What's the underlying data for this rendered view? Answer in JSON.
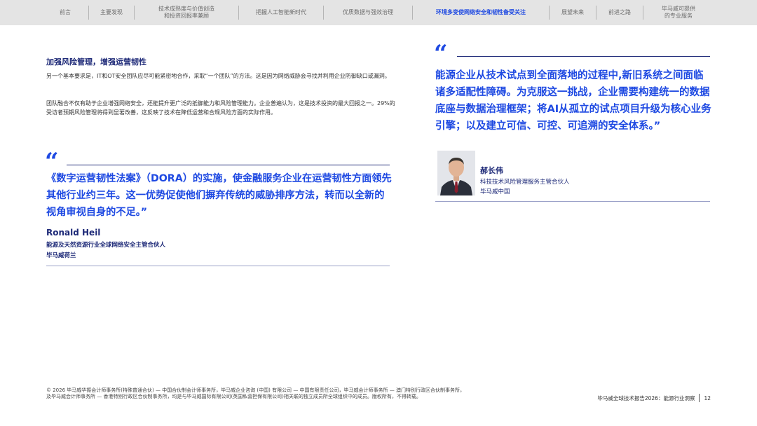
{
  "nav": {
    "items": [
      {
        "label": "前言"
      },
      {
        "label": "主要发现"
      },
      {
        "label": "技术成熟度与价值创造\n和投资回报率兼顾"
      },
      {
        "label": "把握人工智能新时代"
      },
      {
        "label": "优质数据与强效治理"
      },
      {
        "label": "环境多变使网络安全和韧性备受关注"
      },
      {
        "label": "展望未来"
      },
      {
        "label": "前进之路"
      },
      {
        "label": "毕马威可提供\n的专业服务"
      }
    ],
    "active_index": 5
  },
  "left": {
    "heading": "加强风险管理，增强运营韧性",
    "para1": "另一个基本要求是，IT和OT安全团队应尽可能紧密地合作，采取“一个团队”的方法。这是因为网络威胁会寻找并利用企业防御缺口或漏洞。",
    "para2": "团队融合不仅有助于企业增强网络安全，还能提升更广泛的抵御能力和风险管理能力。企业普遍认为，这是技术投资的最大回报之一。29%的受访者预期风险管理将得到显著改善，这反映了技术在降低运营和合规风险方面的实际作用。",
    "quote_mark": "“",
    "quote": "《数字运营韧性法案》（DORA）的实施，使金融服务企业在运营韧性方面领先其他行业约三年。这一优势促使他们摒弃传统的威胁排序方法，转而以全新的视角审视自身的不足。”",
    "person_name": "Ronald Heil",
    "person_title": "能源及天然资源行业全球网络安全主管合伙人",
    "person_org": "毕马威荷兰"
  },
  "right": {
    "quote_mark": "“",
    "quote": "能源企业从技术试点到全面落地的过程中,新旧系统之间面临诸多适配性障碍。为克服这一挑战，企业需要构建统一的数据底座与数据治理框架；将AI从孤立的试点项目升级为核心业务引擎；以及建立可信、可控、可追溯的安全体系。”",
    "person_name": "郝长伟",
    "person_title": "科技技术风险管理服务主管合伙人",
    "person_org": "毕马威中国"
  },
  "footer": {
    "copyright": "© 2026 毕马威华振会计师事务所(特殊普通合伙) — 中国合伙制会计师事务所，毕马威企业咨询 (中国) 有限公司 — 中国有限责任公司，毕马威会计师事务所 — 澳门特别行政区合伙制事务所，及毕马威会计师事务所 — 香港特别行政区合伙制事务所，均是与毕马威国际有限公司(英国私营担保有限公司)相关联的独立成员所全球组织中的成员。版权所有，不得转载。",
    "report_title": "毕马威全球技术报告2026：能源行业洞察",
    "page_number": "12"
  },
  "colors": {
    "accent": "#1e49e2",
    "navy": "#1e2a78",
    "nav_bg": "#e4e4e4"
  }
}
